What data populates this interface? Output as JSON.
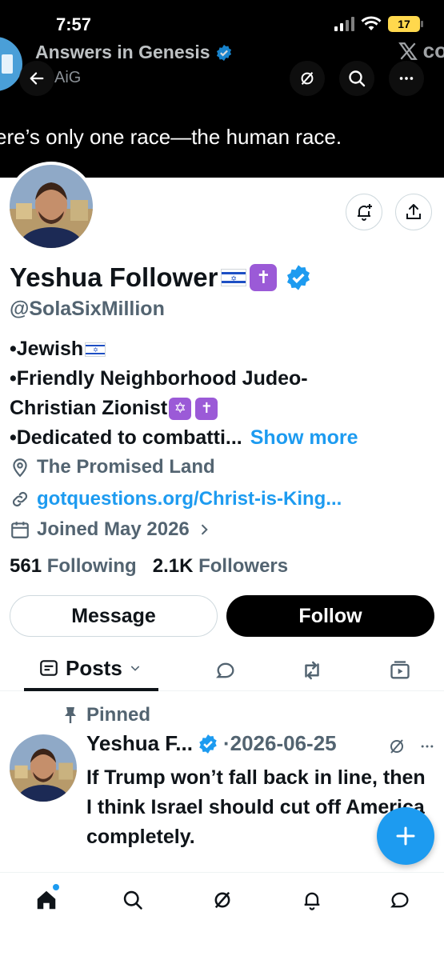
{
  "status_bar": {
    "time": "7:57",
    "battery": "17"
  },
  "banner": {
    "quote_source": "Answers in Genesis",
    "quote_handle": "AiG",
    "brand_text": "co",
    "banner_text": "ere’s only one race—the human race."
  },
  "profile": {
    "name": "Yeshua Follower",
    "handle": "@SolaSixMillion",
    "bio": {
      "line1": "•Jewish",
      "line2": "•Friendly Neighborhood Judeo-",
      "line3": "Christian Zionist",
      "line4": "•Dedicated to combatti...",
      "show_more": "Show more"
    },
    "location": "The Promised Land",
    "link": "gotquestions.org/Christ-is-King...",
    "joined": "Joined May 2026",
    "following_count": "561",
    "following_label": "Following",
    "followers_count": "2.1K",
    "followers_label": "Followers",
    "message_label": "Message",
    "follow_label": "Follow"
  },
  "tabs": {
    "posts_label": "Posts"
  },
  "pinned_tweet": {
    "pinned_label": "Pinned",
    "author": "Yeshua F...",
    "date": "·2026-06-25",
    "text": "If Trump won’t fall back in line, then I think Israel should cut off America completely."
  },
  "colors": {
    "accent": "#1d9bf0",
    "text": "#0f1419",
    "secondary": "#536471",
    "emoji_purple": "#9b5ad7"
  },
  "icons": [
    "back-arrow-icon",
    "grok-icon",
    "search-icon",
    "more-icon",
    "notify-add-icon",
    "share-icon",
    "verified-icon",
    "location-pin-icon",
    "link-icon",
    "calendar-icon",
    "chevron-right-icon",
    "posts-tab-icon",
    "chevron-down-icon",
    "replies-icon",
    "repost-icon",
    "media-icon",
    "pin-icon",
    "plus-icon",
    "home-icon",
    "communities-icon",
    "bell-icon",
    "messages-icon"
  ]
}
